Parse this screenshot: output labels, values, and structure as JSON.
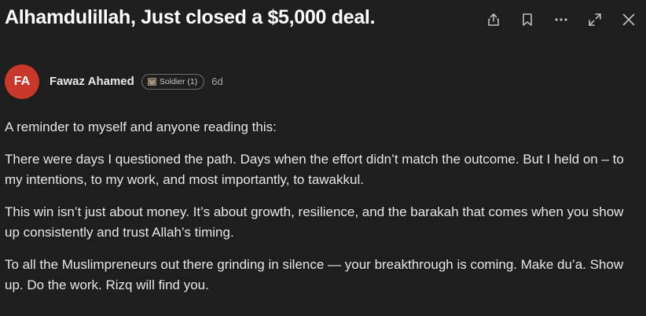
{
  "post": {
    "title": "Alhamdulillah, Just closed a $5,000 deal.",
    "author": {
      "initials": "FA",
      "name": "Fawaz Ahamed",
      "avatar_color": "#c8392b"
    },
    "badge": "Soldier (1)",
    "time": "6d",
    "paragraphs": [
      "A reminder to myself and anyone reading this:",
      "There were days I questioned the path. Days when the effort didn’t match the outcome. But I held on – to my intentions, to my work, and most importantly, to tawakkul.",
      "This win isn’t just about money. It’s about growth, resilience, and the barakah that comes when you show up consistently and trust Allah’s timing.",
      "To all the Muslimpreneurs out there grinding in silence — your breakthrough is coming. Make du’a. Show up. Do the work. Rizq will find you."
    ]
  },
  "toolbar": {
    "icons": [
      "share-icon",
      "bookmark-icon",
      "more-icon",
      "expand-icon",
      "close-icon"
    ]
  },
  "colors": {
    "background": "#1e1e1e",
    "title": "#ffffff",
    "text": "#e6e6e6",
    "muted": "#a8a8a8"
  }
}
